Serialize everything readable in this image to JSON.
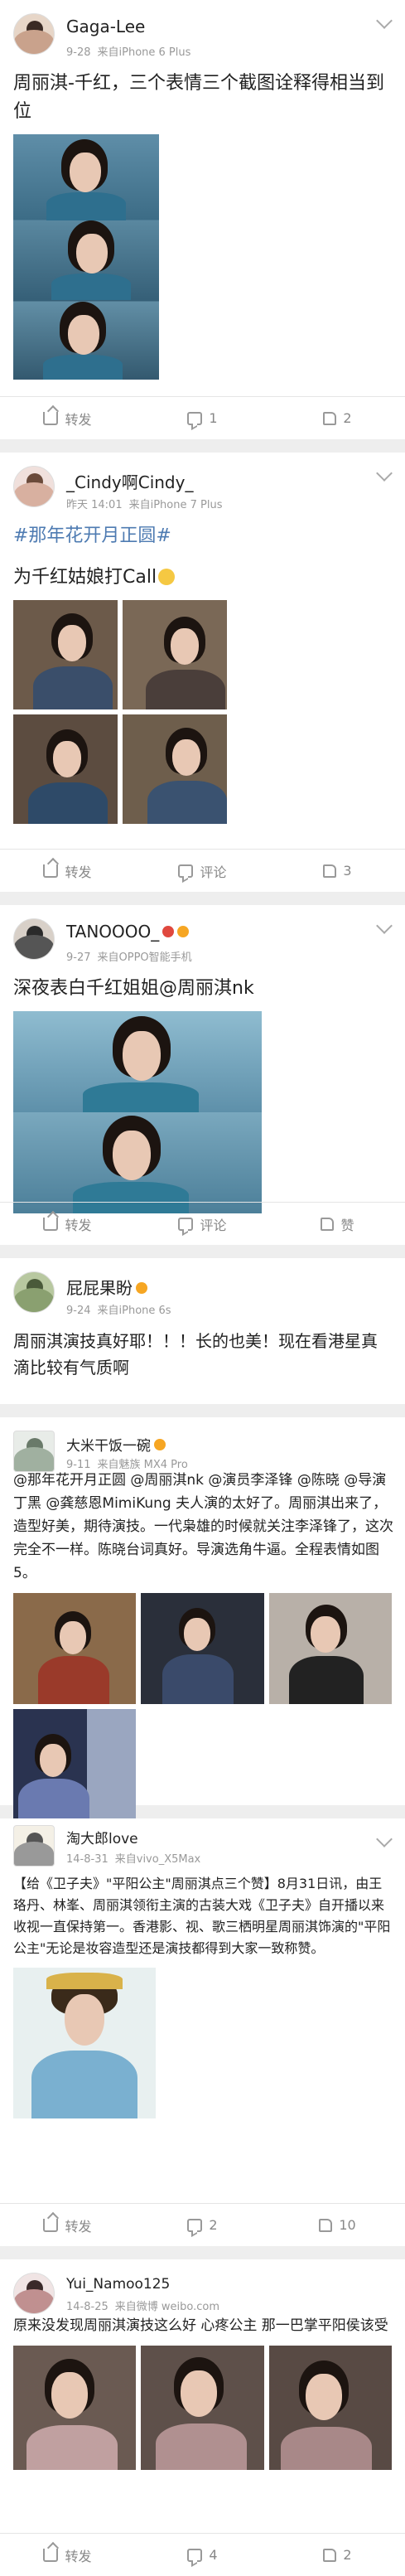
{
  "posts": [
    {
      "user": "Gaga-Lee",
      "time": "9-28",
      "source": "来自iPhone 6 Plus",
      "text": "周丽淇-千红，三个表情三个截图诠释得相当到位",
      "share": "转发",
      "comment": "1",
      "like": "2"
    },
    {
      "user": "_Cindy啊Cindy_",
      "time": "昨天 14:01",
      "source": "来自iPhone 7 Plus",
      "topic": "#那年花开月正圆#",
      "text": "为千红姑娘打Call",
      "share": "转发",
      "comment": "评论",
      "like": "3"
    },
    {
      "user": "TANOOOO_",
      "time": "9-27",
      "source": "来自OPPO智能手机",
      "text": "深夜表白千红姐姐@周丽淇nk",
      "share": "转发",
      "comment": "评论",
      "like": "赞"
    },
    {
      "user": "屁屁果盼",
      "time": "9-24",
      "source": "来自iPhone 6s",
      "text": "周丽淇演技真好耶！！！长的也美！现在看港星真滴比较有气质啊",
      "share": "",
      "comment": "",
      "like": ""
    },
    {
      "user": "大米干饭一碗",
      "time": "9-11",
      "source": "来自魅族 MX4 Pro",
      "text": "@那年花开月正圆 @周丽淇nk @演员李泽锋 @陈晓 @导演丁黑 @龚慈恩MimiKung 夫人演的太好了。周丽淇出来了，造型好美，期待演技。一代枭雄的时候就关注李泽锋了，这次完全不一样。陈晓台词真好。导演选角牛逼。全程表情如图5。"
    },
    {
      "user": "淘大郎love",
      "time": "14-8-31",
      "source": "来自vivo_X5Max",
      "text1": "【给《卫子夫》\"平阳公主\"周丽淇点三个赞】8月31日讯，由王珞丹、林峯、周丽淇领衔主演的古装大戏《卫子夫》自开播以来收视一直保持第一。香港影、视、歌三栖明星周丽淇饰演的\"平阳公主\"无论是妆容造型还是演技都得到大家一致称赞。",
      "text2": "【给《卫子夫》\"平阳公主\"周丽淇点三个赞】",
      "share": "转发",
      "comment": "2",
      "like": "10"
    },
    {
      "user": "Yui_Namoo125",
      "time": "14-8-25",
      "source": "来自微博 weibo.com",
      "text": "原来没发现周丽淇演技这么好 心疼公主 那一巴掌平阳侯该受",
      "share": "转发",
      "comment": "4",
      "like": "2"
    }
  ],
  "icons": [
    "chevron-down-icon",
    "share-icon",
    "comment-icon",
    "like-icon",
    "vip-badge-icon",
    "emoji-icon"
  ],
  "colors": {
    "topic": "#4e7bb2",
    "meta": "#999999",
    "bg": "#eeeeee"
  }
}
